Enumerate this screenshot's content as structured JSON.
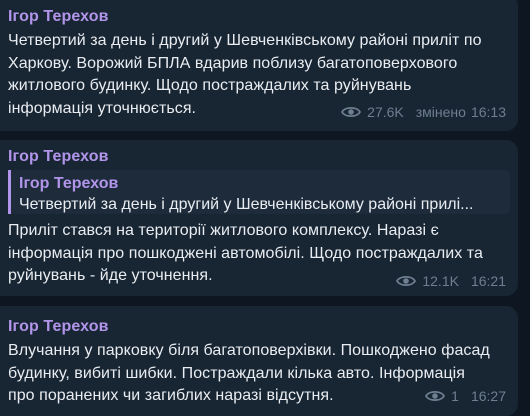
{
  "messages": [
    {
      "author": "Ігор Терехов",
      "lines": [
        "Четвертий за день і другий у Шевченківському районі приліт по",
        "Харкову. Ворожий БПЛА вдарив поблизу багатоповерхового",
        "житлового будинку. Щодо постраждалих та руйнувань",
        "інформація уточнюється."
      ],
      "views": "27.6K",
      "edited_label": "змінено",
      "time": "16:13"
    },
    {
      "author": "Ігор Терехов",
      "reply": {
        "author": "Ігор Терехов",
        "text": "Четвертий за день і другий у Шевченківському районі прилі..."
      },
      "lines": [
        "Приліт стався на території житлового комплексу. Наразі є",
        "інформація про пошкоджені автомобілі. Щодо постраждалих та",
        "руйнувань - йде уточнення."
      ],
      "views": "12.1K",
      "time": "16:21"
    },
    {
      "author": "Ігор Терехов",
      "lines": [
        "Влучання у парковку біля багатоповерхівки. Пошкоджено фасад",
        "будинку, вибиті шибки. Постраждали кілька авто. Інформація",
        "про поранених чи загиблих наразі відсутня."
      ],
      "views": "1",
      "time": "16:27"
    }
  ],
  "colors": {
    "background": "#0e1621",
    "bubble": "#182533",
    "author": "#b195ea",
    "text": "#e9edf1",
    "meta": "#6f7f91"
  },
  "icons": {
    "views": "eye-icon"
  }
}
